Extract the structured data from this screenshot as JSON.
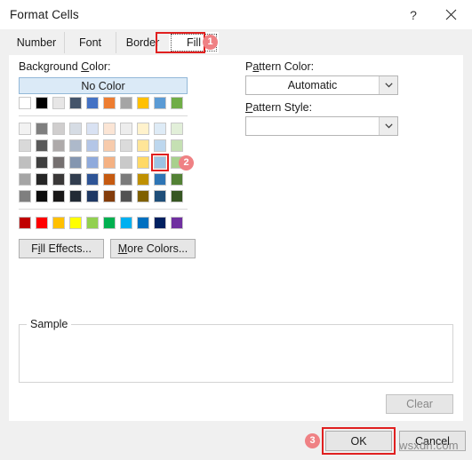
{
  "window": {
    "title": "Format Cells",
    "help_icon": "?",
    "close_icon": "close-icon"
  },
  "tabs": [
    {
      "label": "Number",
      "selected": false
    },
    {
      "label": "Font",
      "selected": false
    },
    {
      "label": "Border",
      "selected": false
    },
    {
      "label": "Fill",
      "selected": true
    }
  ],
  "fill_tab": {
    "background_color_label": "Background Color:",
    "no_color_label": "No Color",
    "pattern_color_label": "Pattern Color:",
    "pattern_color_value": "Automatic",
    "pattern_style_label": "Pattern Style:",
    "pattern_style_value": "",
    "fill_effects_label": "Fill Effects...",
    "more_colors_label": "More Colors...",
    "sample_label": "Sample",
    "clear_label": "Clear"
  },
  "colors": {
    "theme_row": [
      "#ffffff",
      "#000000",
      "#e7e6e6",
      "#44546a",
      "#4472c4",
      "#ed7d31",
      "#a5a5a5",
      "#ffc000",
      "#5b9bd5",
      "#70ad47"
    ],
    "tint_rows": [
      [
        "#f2f2f2",
        "#7f7f7f",
        "#d0cece",
        "#d6dce4",
        "#d9e2f3",
        "#fbe5d5",
        "#ededed",
        "#fff2cc",
        "#deebf6",
        "#e2efd9"
      ],
      [
        "#d9d9d9",
        "#595959",
        "#aeaaaa",
        "#adb9ca",
        "#b4c6e7",
        "#f7cbac",
        "#dbdbdb",
        "#ffe598",
        "#bdd7ee",
        "#c5e0b3"
      ],
      [
        "#bfbfbf",
        "#3f3f3f",
        "#757070",
        "#8496b0",
        "#8faadc",
        "#f4b183",
        "#c9c9c9",
        "#ffd965",
        "#9cc3e5",
        "#a8d08d"
      ],
      [
        "#a5a5a5",
        "#262626",
        "#3a3838",
        "#323e4f",
        "#2e5496",
        "#c55a11",
        "#7b7b7b",
        "#bf9000",
        "#2e75b5",
        "#538135"
      ],
      [
        "#7f7f7f",
        "#0c0c0c",
        "#181717",
        "#222a35",
        "#1f3863",
        "#833c0b",
        "#525252",
        "#7f6000",
        "#1f4e79",
        "#375623"
      ]
    ],
    "standard_row": [
      "#c00000",
      "#ff0000",
      "#ffc000",
      "#ffff00",
      "#92d050",
      "#00b050",
      "#00b0f0",
      "#0070c0",
      "#002060",
      "#7030a0"
    ],
    "selected_swatch": {
      "row": 2,
      "col": 8,
      "hex": "#9cc3e5"
    },
    "highlight_color": "#e02020",
    "badge_color": "#ef8184"
  },
  "annotations": [
    {
      "number": "1",
      "target": "fill-tab"
    },
    {
      "number": "2",
      "target": "selected-swatch"
    },
    {
      "number": "3",
      "target": "ok-button"
    }
  ],
  "footer": {
    "ok_label": "OK",
    "cancel_label": "Cancel",
    "watermark": "wsxdn.com"
  }
}
